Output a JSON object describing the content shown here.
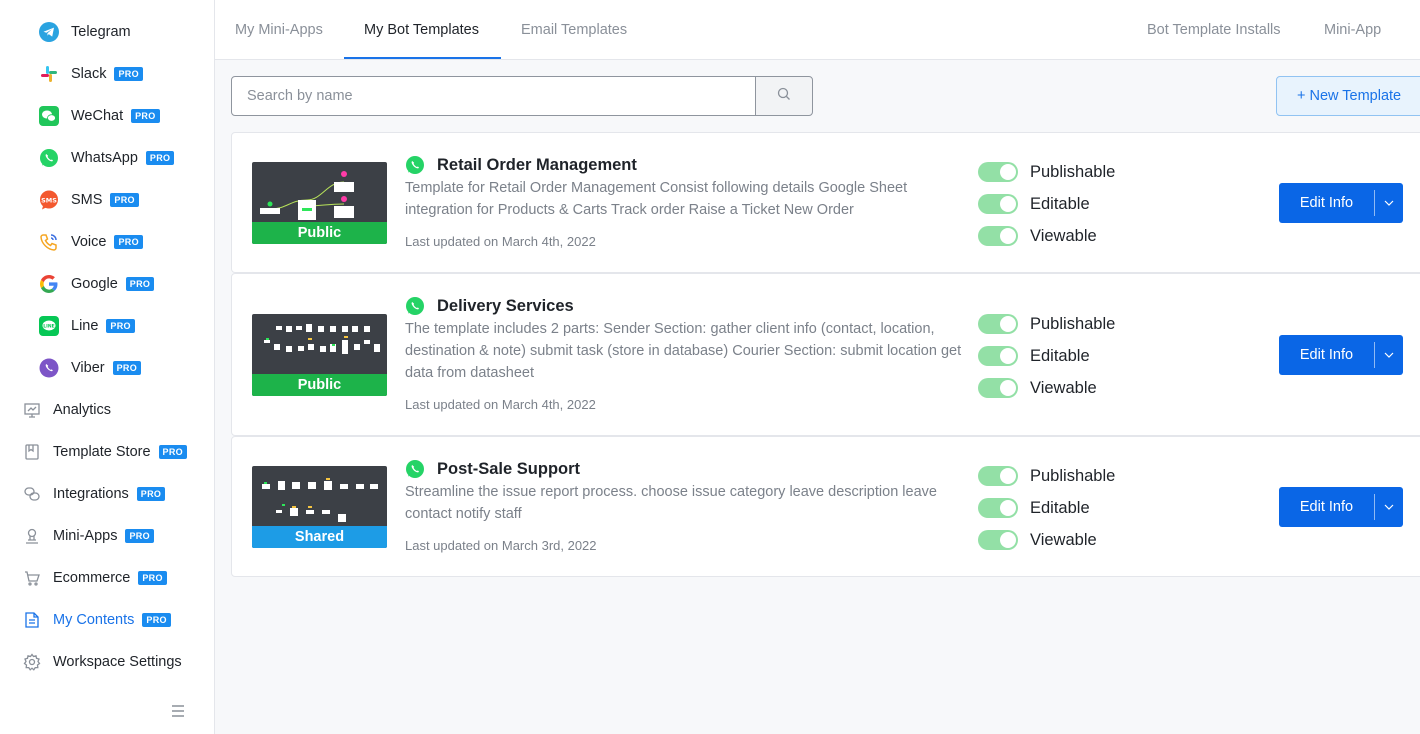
{
  "sidebar": {
    "channels": [
      {
        "label": "Telegram",
        "icon": "telegram-icon",
        "pro": ""
      },
      {
        "label": "Slack",
        "icon": "slack-icon",
        "pro": "PRO"
      },
      {
        "label": "WeChat",
        "icon": "wechat-icon",
        "pro": "PRO"
      },
      {
        "label": "WhatsApp",
        "icon": "whatsapp-icon",
        "pro": "PRO"
      },
      {
        "label": "SMS",
        "icon": "sms-icon",
        "pro": "PRO"
      },
      {
        "label": "Voice",
        "icon": "voice-icon",
        "pro": "PRO"
      },
      {
        "label": "Google",
        "icon": "google-icon",
        "pro": "PRO"
      },
      {
        "label": "Line",
        "icon": "line-icon",
        "pro": "PRO"
      },
      {
        "label": "Viber",
        "icon": "viber-icon",
        "pro": "PRO"
      }
    ],
    "sections": [
      {
        "label": "Analytics",
        "icon": "analytics-icon",
        "pro": ""
      },
      {
        "label": "Template Store",
        "icon": "template-store-icon",
        "pro": "PRO"
      },
      {
        "label": "Integrations",
        "icon": "integrations-icon",
        "pro": "PRO"
      },
      {
        "label": "Mini-Apps",
        "icon": "mini-apps-icon",
        "pro": "PRO"
      },
      {
        "label": "Ecommerce",
        "icon": "ecommerce-icon",
        "pro": "PRO"
      },
      {
        "label": "My Contents",
        "icon": "my-contents-icon",
        "pro": "PRO",
        "active": true
      },
      {
        "label": "Workspace Settings",
        "icon": "gear-icon",
        "pro": ""
      }
    ]
  },
  "tabs": {
    "left": [
      "My Mini-Apps",
      "My Bot Templates",
      "Email Templates"
    ],
    "right": [
      "Bot Template Installs",
      "Mini-App Sales"
    ],
    "active": "My Bot Templates"
  },
  "search": {
    "placeholder": "Search by name",
    "value": ""
  },
  "new_template_label": "+ New Template",
  "templates": [
    {
      "title": "Retail Order Management",
      "badge": "Public",
      "description": "Template for Retail Order Management Consist following details Google Sheet integration for Products & Carts Track order Raise a Ticket New Order",
      "updated": "Last updated on March 4th, 2022",
      "toggles": [
        "Publishable",
        "Editable",
        "Viewable"
      ],
      "edit_label": "Edit Info"
    },
    {
      "title": "Delivery Services",
      "badge": "Public",
      "description": "The template includes 2 parts: Sender Section: gather client info (contact, location, destination & note) submit task (store in database) Courier Section: submit location get data from datasheet",
      "updated": "Last updated on March 4th, 2022",
      "toggles": [
        "Publishable",
        "Editable",
        "Viewable"
      ],
      "edit_label": "Edit Info"
    },
    {
      "title": "Post-Sale Support",
      "badge": "Shared",
      "description": "Streamline the issue report process. choose issue category leave description leave contact notify staff",
      "updated": "Last updated on March 3rd, 2022",
      "toggles": [
        "Publishable",
        "Editable",
        "Viewable"
      ],
      "edit_label": "Edit Info"
    }
  ],
  "colors": {
    "accent": "#0a66e6",
    "public_badge": "#1db34a",
    "shared_badge": "#1d9ce6",
    "toggle_on": "#93e0a6",
    "pro_badge": "#1a8cf0"
  }
}
